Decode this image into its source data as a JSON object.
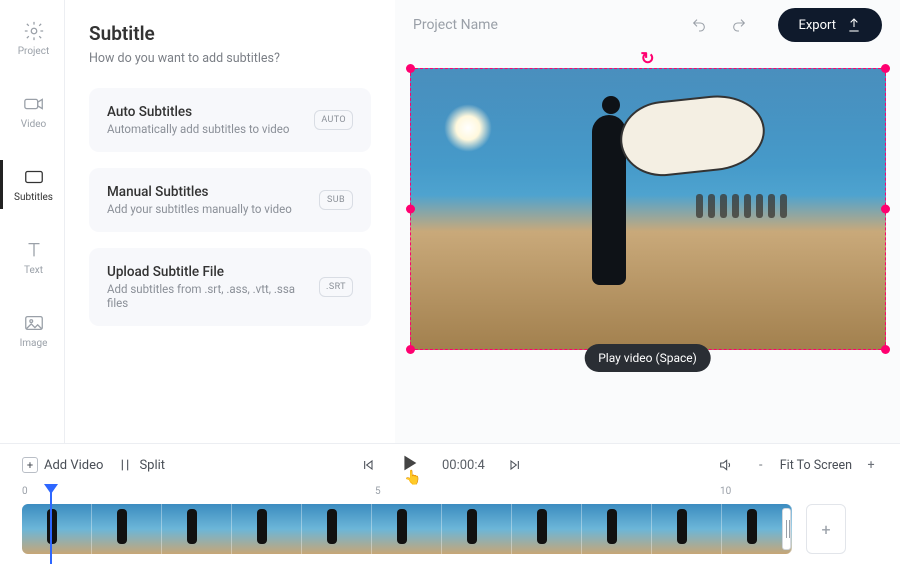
{
  "leftnav": {
    "items": [
      {
        "label": "Project"
      },
      {
        "label": "Video"
      },
      {
        "label": "Subtitles"
      },
      {
        "label": "Text"
      },
      {
        "label": "Image"
      }
    ]
  },
  "panel": {
    "title": "Subtitle",
    "question": "How do you want to add subtitles?",
    "cards": [
      {
        "title": "Auto Subtitles",
        "desc": "Automatically add subtitles to video",
        "badge": "AUTO"
      },
      {
        "title": "Manual Subtitles",
        "desc": "Add your subtitles manually to video",
        "badge": "SUB"
      },
      {
        "title": "Upload Subtitle File",
        "desc": "Add subtitles from .srt, .ass, .vtt, .ssa files",
        "badge": ".SRT"
      }
    ]
  },
  "header": {
    "project_placeholder": "Project Name",
    "export_label": "Export"
  },
  "preview": {
    "tooltip": "Play video (Space)"
  },
  "controls": {
    "add_video": "Add Video",
    "split": "Split",
    "time": "00:00:4",
    "fit_label": "Fit To Screen"
  },
  "ruler": {
    "t0": "0",
    "t1": "5",
    "t2": "10"
  },
  "timeline": {
    "clip_count": 11
  },
  "icons": {
    "project": "gear-icon",
    "video": "camera-icon",
    "subtitles": "subtitle-icon",
    "text": "text-icon",
    "image": "image-icon"
  },
  "colors": {
    "accent": "#ff0070",
    "export_bg": "#0f1a2c",
    "playhead": "#2e67ff"
  }
}
